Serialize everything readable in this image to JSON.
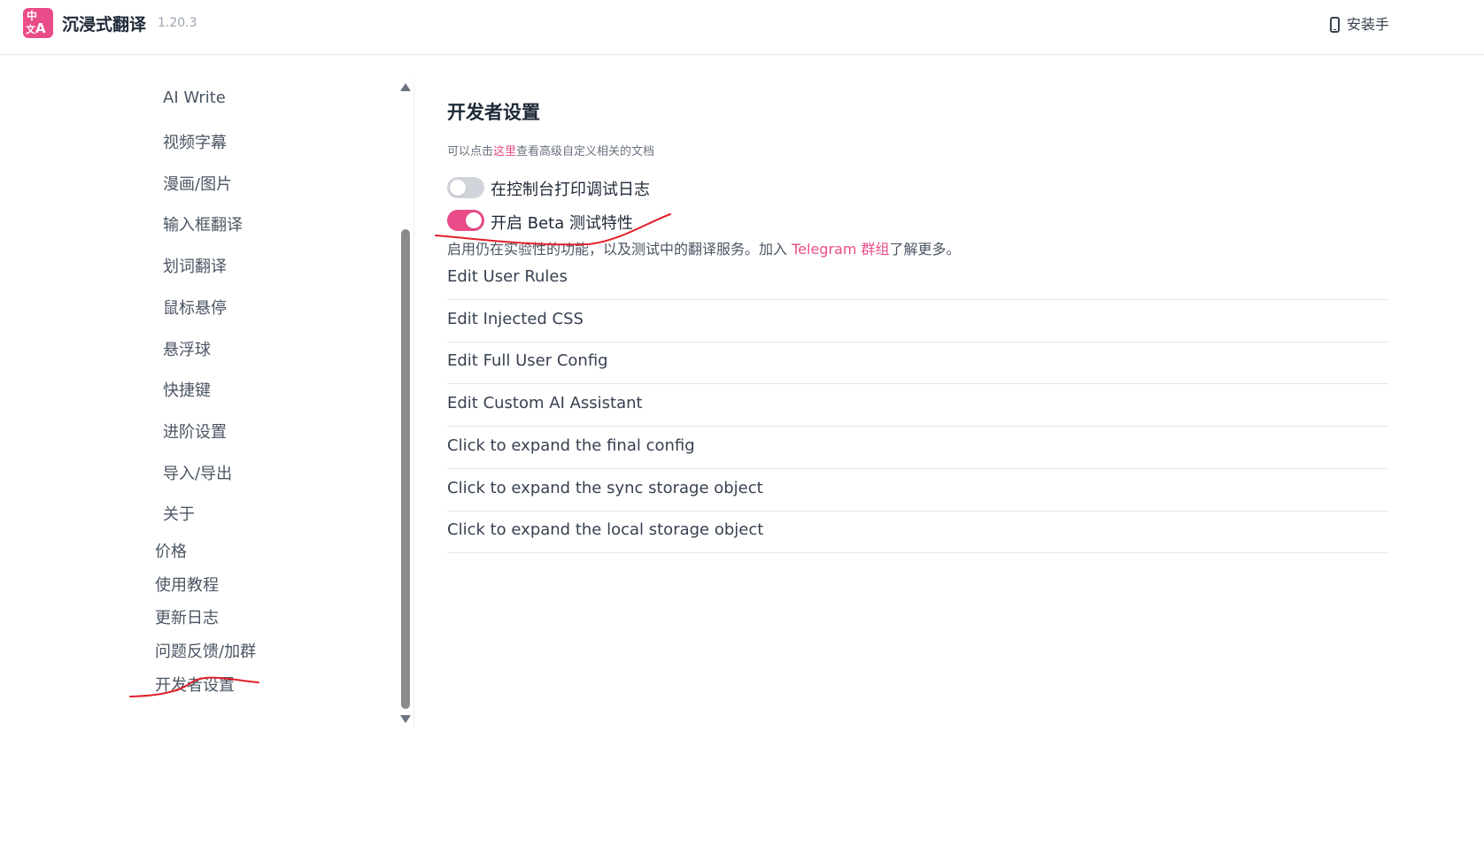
{
  "header": {
    "logo_text_top": "中",
    "logo_text_bottom": "A",
    "logo_text_side": "文",
    "title": "沉浸式翻译",
    "version": "1.20.3",
    "install_label": "安装手"
  },
  "sidebar": {
    "sub_items": [
      {
        "label": "AI Write"
      },
      {
        "label": "视频字幕"
      },
      {
        "label": "漫画/图片"
      },
      {
        "label": "输入框翻译"
      },
      {
        "label": "划词翻译"
      },
      {
        "label": "鼠标悬停"
      },
      {
        "label": "悬浮球"
      },
      {
        "label": "快捷键"
      },
      {
        "label": "进阶设置"
      },
      {
        "label": "导入/导出"
      },
      {
        "label": "关于"
      }
    ],
    "top_items": [
      {
        "label": "价格"
      },
      {
        "label": "使用教程"
      },
      {
        "label": "更新日志"
      },
      {
        "label": "问题反馈/加群"
      },
      {
        "label": "开发者设置"
      }
    ]
  },
  "main": {
    "title": "开发者设置",
    "desc_prefix": "可以点击",
    "desc_link": "这里",
    "desc_suffix": "查看高级自定义相关的文档",
    "toggles": [
      {
        "label": "在控制台打印调试日志",
        "on": false
      },
      {
        "label": "开启 Beta 测试特性",
        "on": true
      }
    ],
    "beta_desc_prefix": "启用仍在实验性的功能，以及测试中的翻译服务。加入 ",
    "beta_desc_link": "Telegram 群组",
    "beta_desc_suffix": "了解更多。",
    "rows": [
      {
        "label": "Edit User Rules"
      },
      {
        "label": "Edit Injected CSS"
      },
      {
        "label": "Edit Full User Config"
      },
      {
        "label": "Edit Custom AI Assistant"
      },
      {
        "label": "Click to expand the final config"
      },
      {
        "label": "Click to expand the sync storage object"
      },
      {
        "label": "Click to expand the local storage object"
      }
    ]
  },
  "colors": {
    "accent": "#ea4c89",
    "annotation": "#e0202a"
  }
}
